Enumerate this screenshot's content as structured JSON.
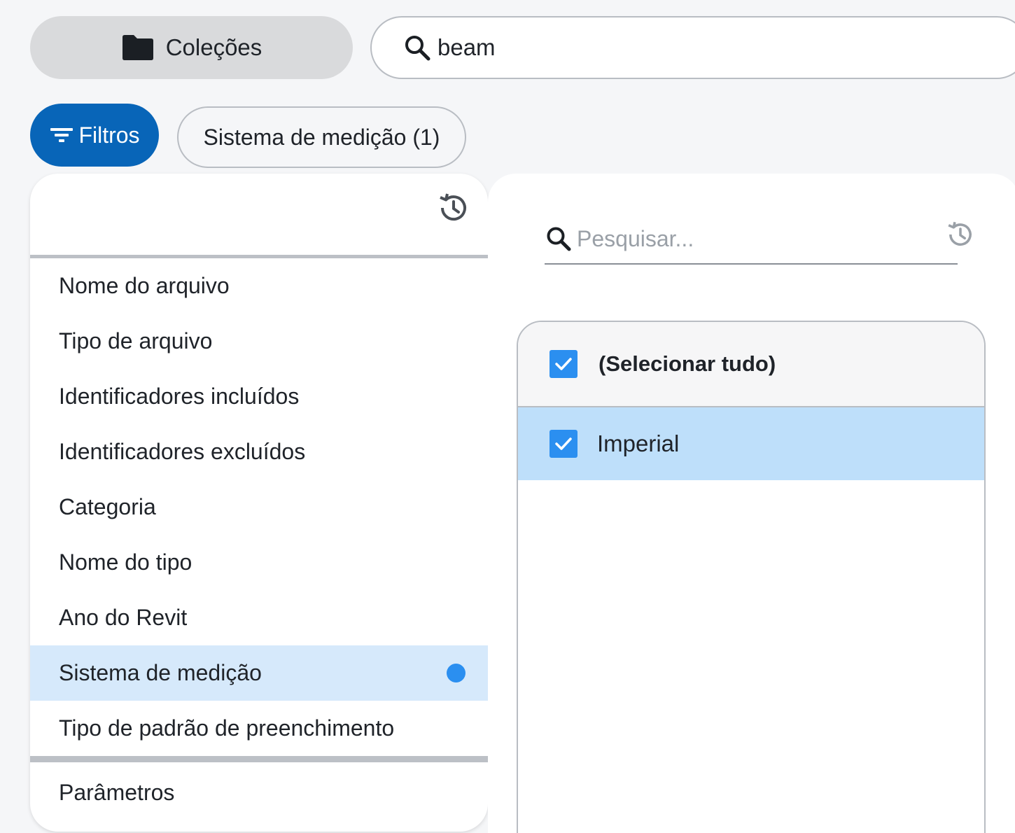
{
  "toolbar": {
    "collections_label": "Coleções",
    "search_value": "beam"
  },
  "filters": {
    "button_label": "Filtros",
    "chip_label": "Sistema de medição (1)"
  },
  "left_panel": {
    "items": [
      {
        "label": "Nome do arquivo"
      },
      {
        "label": "Tipo de arquivo"
      },
      {
        "label": "Identificadores incluídos"
      },
      {
        "label": "Identificadores excluídos"
      },
      {
        "label": "Categoria"
      },
      {
        "label": "Nome do tipo"
      },
      {
        "label": "Ano do Revit"
      },
      {
        "label": "Sistema de medição",
        "active": true
      },
      {
        "label": "Tipo de padrão de preenchimento"
      }
    ],
    "params_label": "Parâmetros"
  },
  "right_panel": {
    "search_placeholder": "Pesquisar...",
    "select_all_label": "(Selecionar tudo)",
    "select_all_checked": true,
    "options": [
      {
        "label": "Imperial",
        "checked": true
      }
    ]
  },
  "colors": {
    "primary": "#0865b8",
    "active_row": "#d6e9fb",
    "selected_option": "#bedffa",
    "checkbox": "#2b8ff0",
    "indicator_dot": "#2b8ff0"
  }
}
